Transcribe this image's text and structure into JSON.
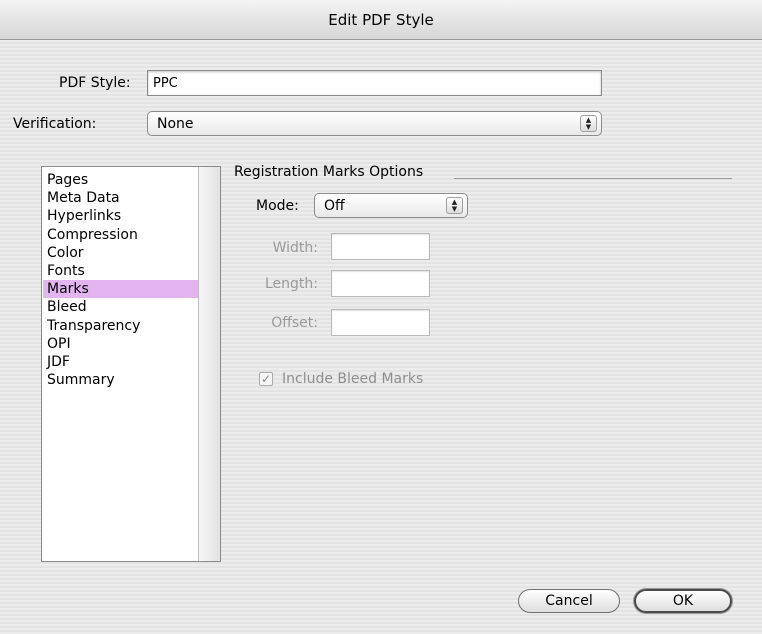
{
  "window": {
    "title": "Edit PDF Style"
  },
  "form": {
    "pdf_style_label": "PDF Style:",
    "pdf_style_value": "PPC",
    "verification_label": "Verification:",
    "verification_value": "None"
  },
  "sidebar": {
    "items": [
      {
        "label": "Pages"
      },
      {
        "label": "Meta Data"
      },
      {
        "label": "Hyperlinks"
      },
      {
        "label": "Compression"
      },
      {
        "label": "Color"
      },
      {
        "label": "Fonts"
      },
      {
        "label": "Marks",
        "selected": true
      },
      {
        "label": "Bleed"
      },
      {
        "label": "Transparency"
      },
      {
        "label": "OPI"
      },
      {
        "label": "JDF"
      },
      {
        "label": "Summary"
      }
    ]
  },
  "panel": {
    "title": "Registration Marks Options",
    "mode_label": "Mode:",
    "mode_value": "Off",
    "width_label": "Width:",
    "width_value": "",
    "length_label": "Length:",
    "length_value": "",
    "offset_label": "Offset:",
    "offset_value": "",
    "include_bleed_label": "Include Bleed Marks",
    "include_bleed_checked": true
  },
  "buttons": {
    "cancel": "Cancel",
    "ok": "OK"
  },
  "colors": {
    "selection": "#e3b4f0"
  }
}
